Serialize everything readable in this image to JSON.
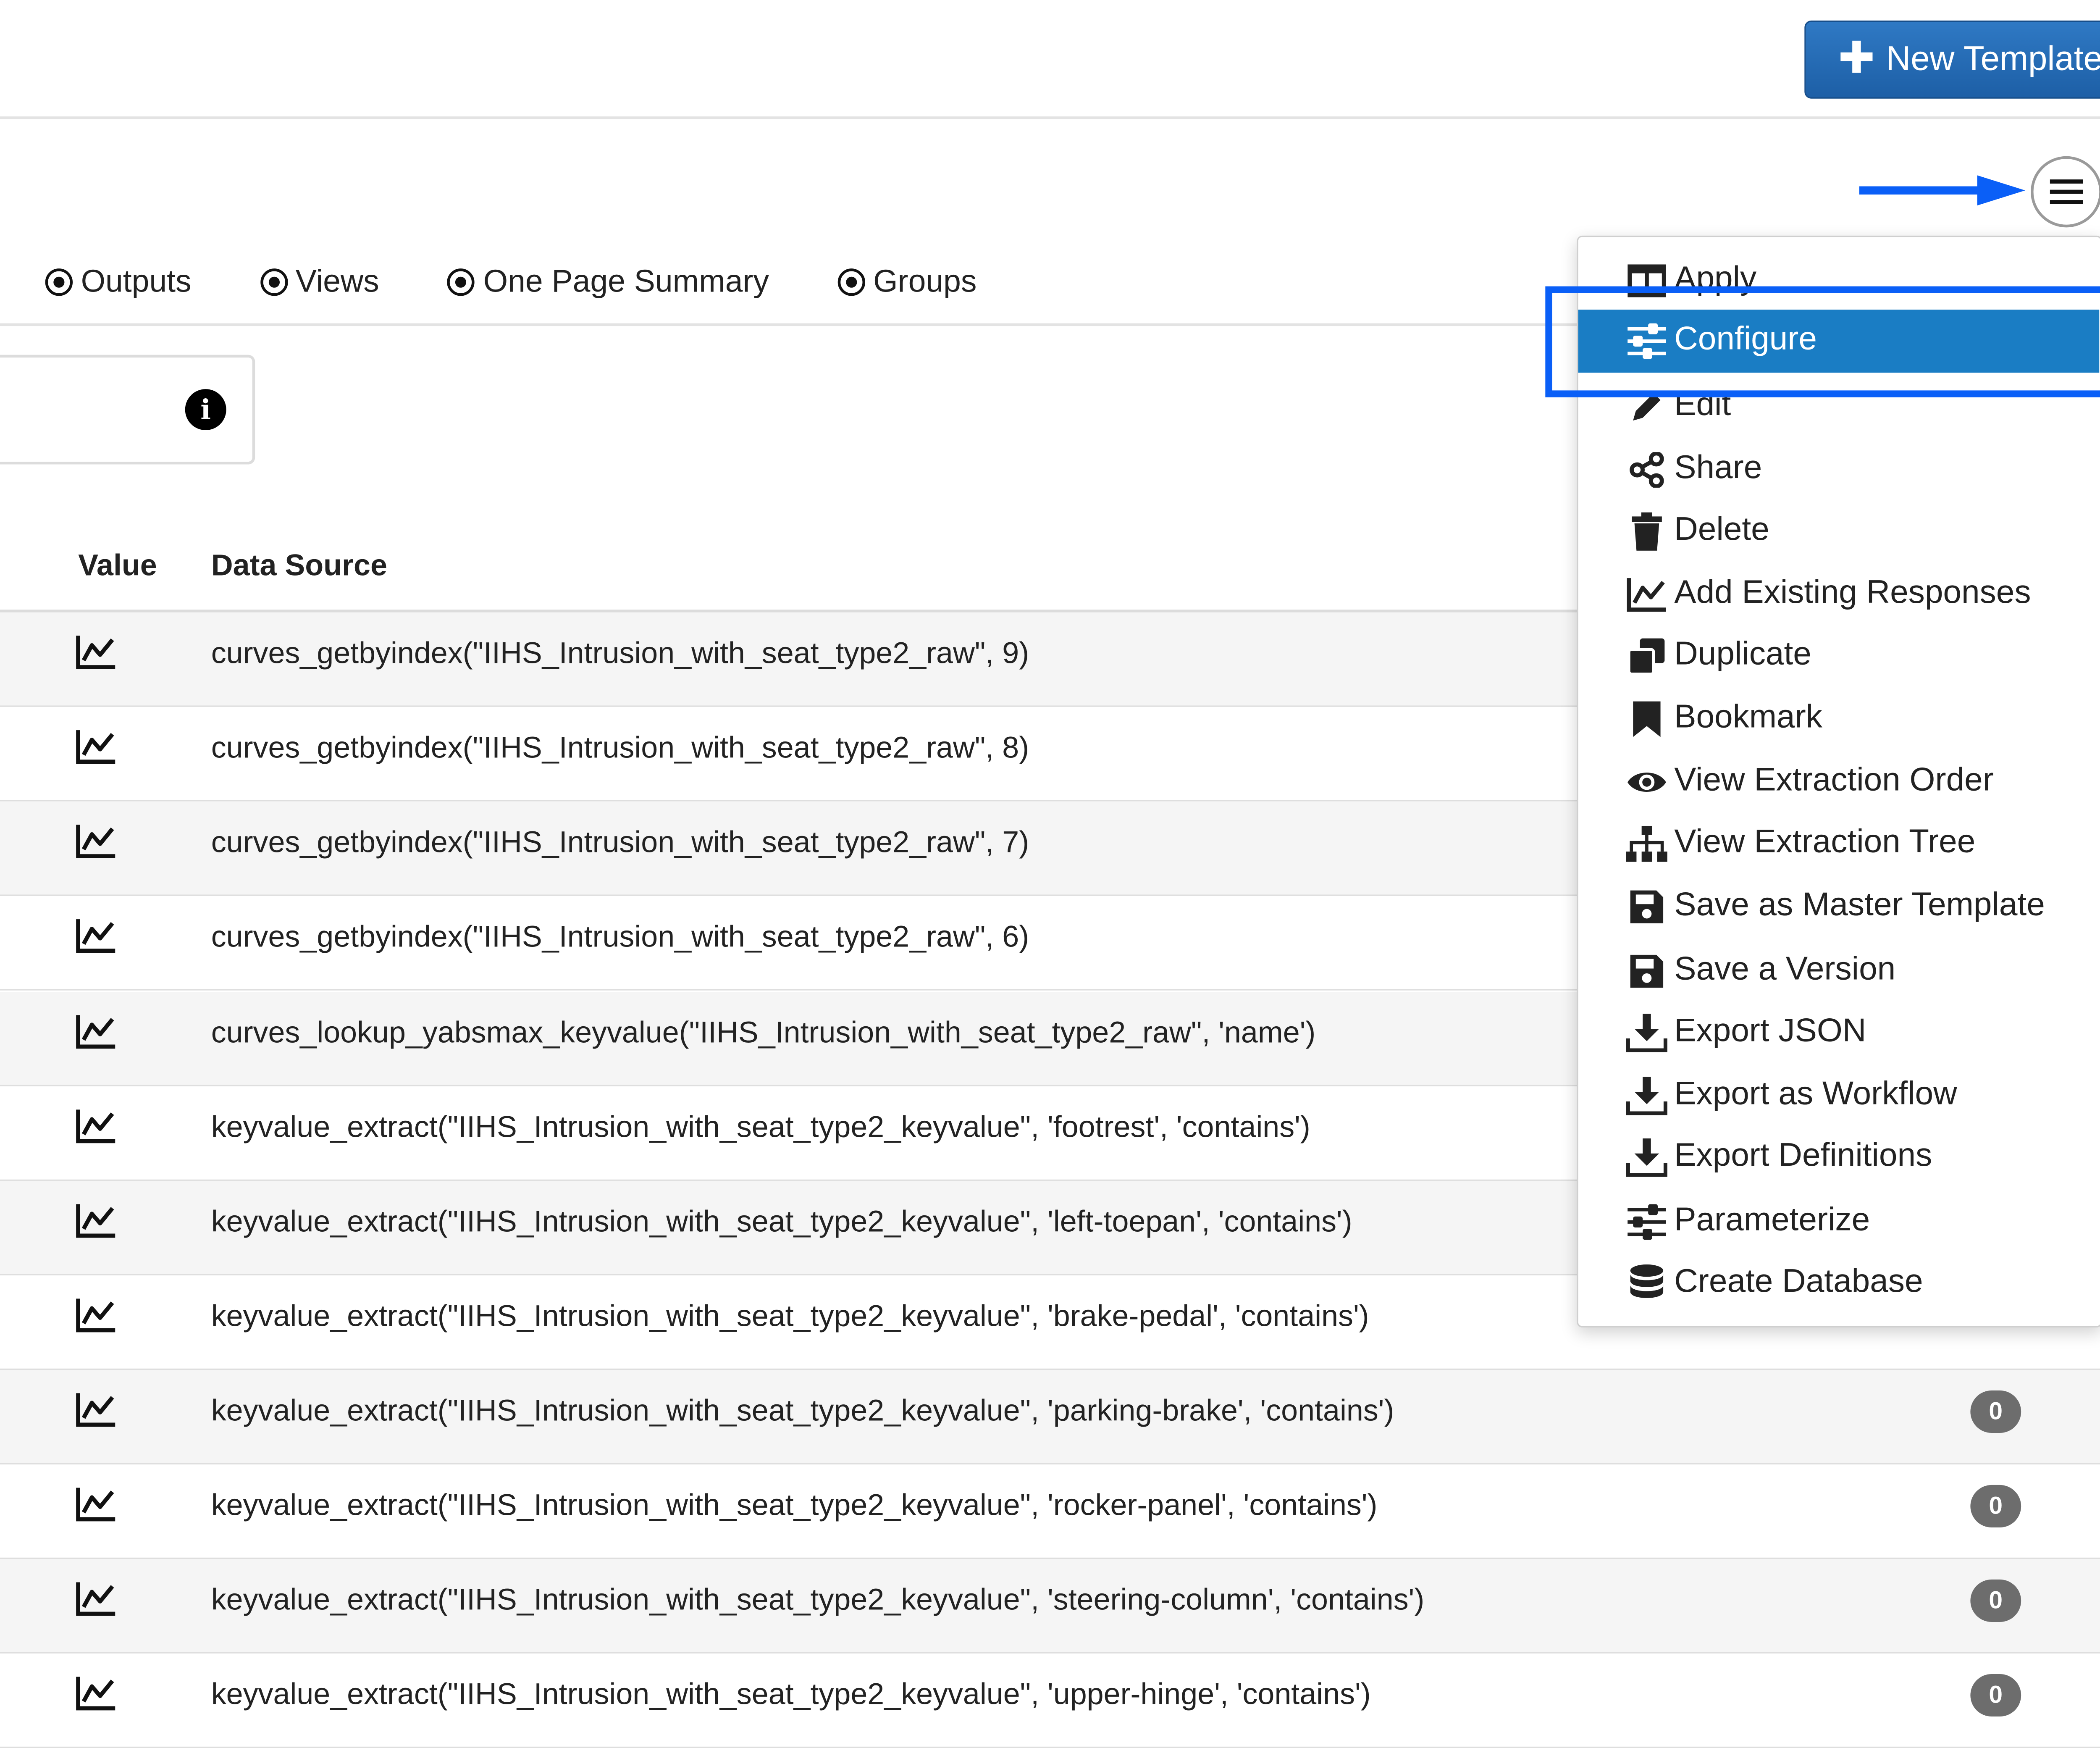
{
  "header": {
    "new_template_label": "New Template"
  },
  "tabs": [
    {
      "label": "Outputs"
    },
    {
      "label": "Views"
    },
    {
      "label": "One Page Summary"
    },
    {
      "label": "Groups"
    }
  ],
  "table": {
    "columns": [
      "Value",
      "Data Source"
    ],
    "rows": [
      {
        "data_source": "curves_getbyindex(\"IIHS_Intrusion_with_seat_type2_raw\", 9)",
        "badge": ""
      },
      {
        "data_source": "curves_getbyindex(\"IIHS_Intrusion_with_seat_type2_raw\", 8)",
        "badge": ""
      },
      {
        "data_source": "curves_getbyindex(\"IIHS_Intrusion_with_seat_type2_raw\", 7)",
        "badge": ""
      },
      {
        "data_source": "curves_getbyindex(\"IIHS_Intrusion_with_seat_type2_raw\", 6)",
        "badge": ""
      },
      {
        "data_source": "curves_lookup_yabsmax_keyvalue(\"IIHS_Intrusion_with_seat_type2_raw\", 'name')",
        "badge": ""
      },
      {
        "data_source": "keyvalue_extract(\"IIHS_Intrusion_with_seat_type2_keyvalue\", 'footrest', 'contains')",
        "badge": ""
      },
      {
        "data_source": "keyvalue_extract(\"IIHS_Intrusion_with_seat_type2_keyvalue\", 'left-toepan', 'contains')",
        "badge": ""
      },
      {
        "data_source": "keyvalue_extract(\"IIHS_Intrusion_with_seat_type2_keyvalue\", 'brake-pedal', 'contains')",
        "badge": ""
      },
      {
        "data_source": "keyvalue_extract(\"IIHS_Intrusion_with_seat_type2_keyvalue\", 'parking-brake', 'contains')",
        "badge": "0"
      },
      {
        "data_source": "keyvalue_extract(\"IIHS_Intrusion_with_seat_type2_keyvalue\", 'rocker-panel', 'contains')",
        "badge": "0"
      },
      {
        "data_source": "keyvalue_extract(\"IIHS_Intrusion_with_seat_type2_keyvalue\", 'steering-column', 'contains')",
        "badge": "0"
      },
      {
        "data_source": "keyvalue_extract(\"IIHS_Intrusion_with_seat_type2_keyvalue\", 'upper-hinge', 'contains')",
        "badge": "0"
      }
    ]
  },
  "menu": {
    "items": [
      {
        "label": "Apply",
        "icon": "columns-icon"
      },
      {
        "label": "Configure",
        "icon": "sliders-icon",
        "active": true
      },
      {
        "label": "Edit",
        "icon": "pencil-icon"
      },
      {
        "label": "Share",
        "icon": "share-icon"
      },
      {
        "label": "Delete",
        "icon": "trash-icon"
      },
      {
        "label": "Add Existing Responses",
        "icon": "line-chart-icon"
      },
      {
        "label": "Duplicate",
        "icon": "copy-icon"
      },
      {
        "label": "Bookmark",
        "icon": "bookmark-icon"
      },
      {
        "label": "View Extraction Order",
        "icon": "eye-icon"
      },
      {
        "label": "View Extraction Tree",
        "icon": "sitemap-icon"
      },
      {
        "label": "Save as Master Template",
        "icon": "save-icon"
      },
      {
        "label": "Save a Version",
        "icon": "save-icon"
      },
      {
        "label": "Export JSON",
        "icon": "download-icon"
      },
      {
        "label": "Export as Workflow",
        "icon": "download-icon"
      },
      {
        "label": "Export Definitions",
        "icon": "download-icon"
      },
      {
        "label": "Parameterize",
        "icon": "sliders-icon"
      },
      {
        "label": "Create Database",
        "icon": "database-icon"
      }
    ]
  },
  "colors": {
    "primary_button": "#2f79c4",
    "menu_active": "#1a7dc4",
    "annotation": "#0a5ff7",
    "badge": "#6d6d6d"
  }
}
